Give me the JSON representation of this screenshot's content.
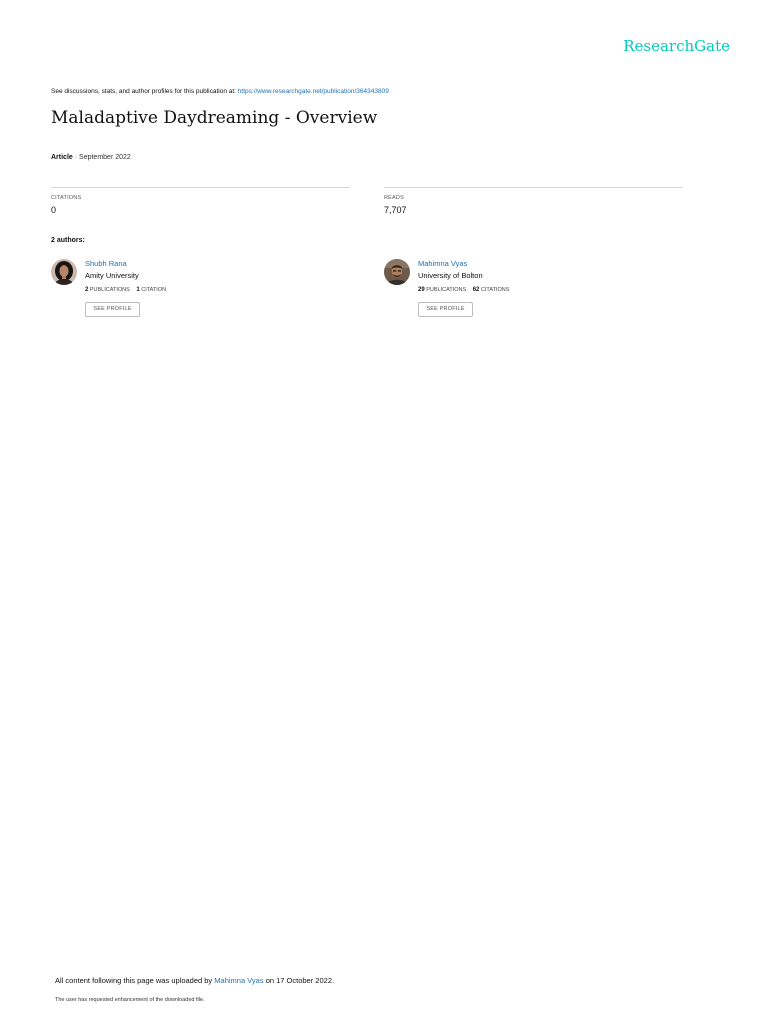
{
  "header": {
    "logo_text": "ResearchGate",
    "logo_color": "#00ccbb"
  },
  "discussion": {
    "prefix": "See discussions, stats, and author profiles for this publication at: ",
    "link_text": "https://www.researchgate.net/publication/364343809"
  },
  "publication": {
    "title": "Maladaptive Daydreaming - Overview",
    "type": "Article",
    "date_separator": " · ",
    "date": "September 2022"
  },
  "stats": {
    "citations_label": "CITATIONS",
    "citations_value": "0",
    "reads_label": "READS",
    "reads_value": "7,707"
  },
  "authors_heading": "2 authors:",
  "authors": [
    {
      "name": "Shubh Rana",
      "institution": "Amity University",
      "publications_count": "2",
      "publications_label": "PUBLICATIONS",
      "citations_count": "1",
      "citations_label": "CITATION",
      "button_label": "SEE PROFILE",
      "avatar_icon": "author-photo-icon"
    },
    {
      "name": "Mahimna Vyas",
      "institution": "University of Bolton",
      "publications_count": "29",
      "publications_label": "PUBLICATIONS",
      "citations_count": "62",
      "citations_label": "CITATIONS",
      "button_label": "SEE PROFILE",
      "avatar_icon": "author-photo-icon"
    }
  ],
  "footer": {
    "upload_prefix": "All content following this page was uploaded by ",
    "uploader": "Mahimna Vyas",
    "upload_suffix": " on 17 October 2022.",
    "note": "The user has requested enhancement of the downloaded file."
  },
  "colors": {
    "link": "#1f6fb5",
    "rule": "#d6d6d6"
  }
}
